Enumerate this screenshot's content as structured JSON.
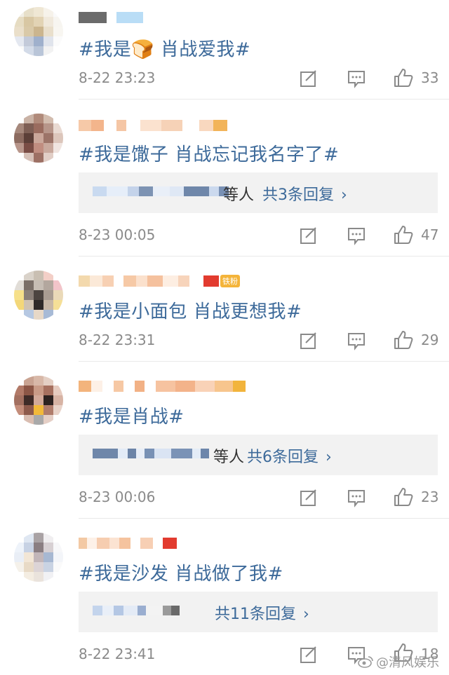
{
  "comments": [
    {
      "text": "#我是🍞 肖战爱我#",
      "time": "8-22 23:23",
      "likes": "33",
      "reply": null
    },
    {
      "text": "#我是馓子 肖战忘记我名字了#",
      "time": "8-23 00:05",
      "likes": "47",
      "reply": {
        "suffix": "等人",
        "more": "共3条回复"
      }
    },
    {
      "text": "#我是小面包 肖战更想我#",
      "time": "8-22 23:31",
      "likes": "29",
      "reply": null,
      "badge": "铁粉"
    },
    {
      "text": "#我是肖战#",
      "time": "8-23 00:06",
      "likes": "23",
      "reply": {
        "suffix": "等人",
        "more": "共6条回复"
      }
    },
    {
      "text": "#我是沙发  肖战做了我#",
      "time": "8-22 23:41",
      "likes": "18",
      "reply": {
        "suffix": "",
        "more": "共11条回复"
      }
    }
  ],
  "icons": {
    "edit": "edit-icon",
    "comment": "comment-icon",
    "like": "thumbs-up-icon",
    "chevron": "chevron-right-icon"
  },
  "watermark": "@清风娱乐",
  "colors": {
    "link": "#3d6a9a",
    "meta": "#8a8a8a",
    "reply_bg": "#f2f2f2"
  }
}
